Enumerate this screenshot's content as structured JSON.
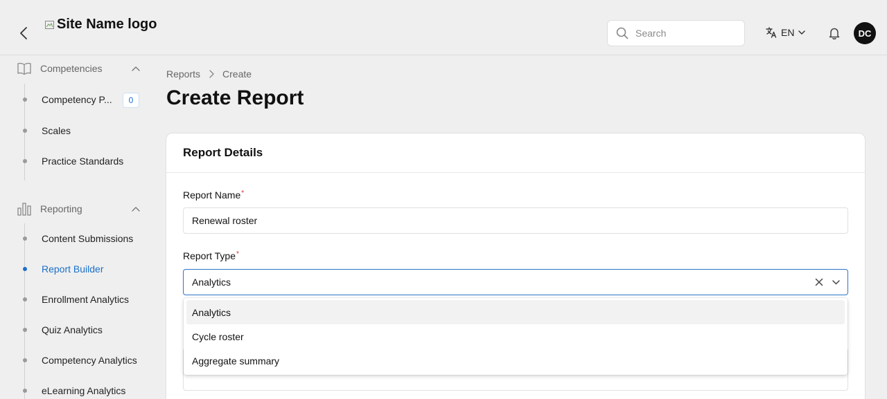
{
  "header": {
    "logo_alt": "Site Name logo",
    "search_placeholder": "Search",
    "language": "EN",
    "avatar_initials": "DC"
  },
  "sidebar": {
    "competencies": {
      "label": "Competencies",
      "items": [
        {
          "label": "Competency P...",
          "badge": "0"
        },
        {
          "label": "Scales"
        },
        {
          "label": "Practice Standards"
        }
      ]
    },
    "reporting": {
      "label": "Reporting",
      "items": [
        {
          "label": "Content Submissions"
        },
        {
          "label": "Report Builder",
          "active": true
        },
        {
          "label": "Enrollment Analytics"
        },
        {
          "label": "Quiz Analytics"
        },
        {
          "label": "Competency Analytics"
        },
        {
          "label": "eLearning Analytics"
        }
      ]
    }
  },
  "breadcrumb": [
    "Reports",
    "Create"
  ],
  "page_title": "Create Report",
  "card": {
    "title": "Report Details",
    "report_name_label": "Report Name",
    "report_name_value": "Renewal roster",
    "report_type_label": "Report Type",
    "report_type_value": "Analytics"
  },
  "dropdown": {
    "options": [
      "Analytics",
      "Cycle roster",
      "Aggregate summary"
    ],
    "highlighted": "Analytics"
  },
  "colors": {
    "accent": "#1a6fc8",
    "required": "#d32f2f",
    "background": "#efefef"
  }
}
